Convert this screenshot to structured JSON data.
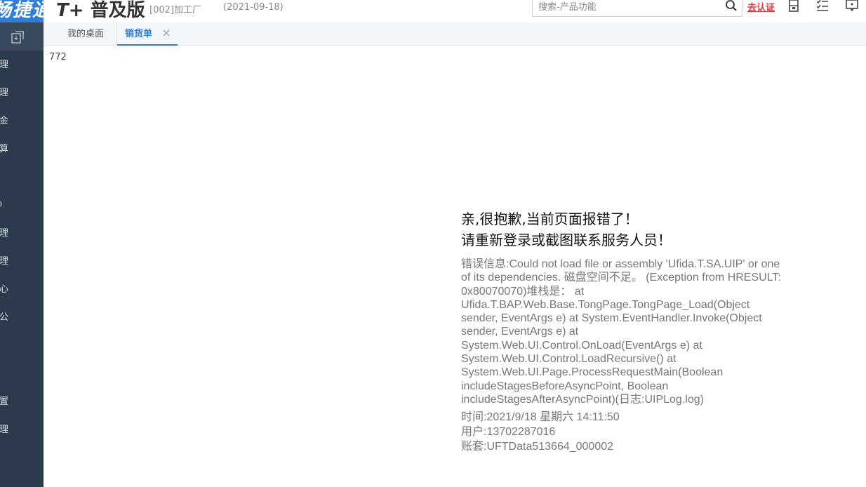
{
  "header": {
    "brand_text": "畅捷通",
    "logo_main": "T+",
    "logo_sub": "普及版",
    "company": "[002]加工厂",
    "date": "(2021-09-18)",
    "search_placeholder": "搜索-产品功能",
    "verify_label": "去认证",
    "icons": [
      "search-icon",
      "calculator-icon",
      "task-list-icon",
      "message-icon"
    ]
  },
  "sidebar": {
    "top_icon": "new-window-icon",
    "items": [
      {
        "label": "理"
      },
      {
        "label": "理"
      },
      {
        "label": "金"
      },
      {
        "label": "算"
      },
      {
        "label": "》"
      },
      {
        "label": "理"
      },
      {
        "label": "理"
      },
      {
        "label": "心"
      },
      {
        "label": "公"
      },
      {
        "label": "置"
      },
      {
        "label": "理"
      }
    ]
  },
  "tabs": [
    {
      "label": "我的桌面"
    },
    {
      "label": "销货单"
    }
  ],
  "content": {
    "code": "772",
    "error_title_line1": "亲,很抱歉,当前页面报错了！",
    "error_title_line2": "请重新登录或截图联系服务人员！",
    "error_detail": "错误信息:Could not load file or assembly 'Ufida.T.SA.UIP' or one of its dependencies. 磁盘空间不足。 (Exception from HRESULT: 0x80070070)堆栈是： at Ufida.T.BAP.Web.Base.TongPage.TongPage_Load(Object sender, EventArgs e) at System.EventHandler.Invoke(Object sender, EventArgs e) at System.Web.UI.Control.OnLoad(EventArgs e) at System.Web.UI.Control.LoadRecursive() at System.Web.UI.Page.ProcessRequestMain(Boolean includeStagesBeforeAsyncPoint, Boolean includeStagesAfterAsyncPoint)(日志:UIPLog.log)",
    "time_line": "时间:2021/9/18 星期六 14:11:50",
    "user_line": "用户:13702287016",
    "account_line": "账套:UFTData513664_000002"
  },
  "colors": {
    "accent": "#2f7fd8",
    "sidebar_bg": "#2b3a4c",
    "link_red": "#e0333a"
  }
}
